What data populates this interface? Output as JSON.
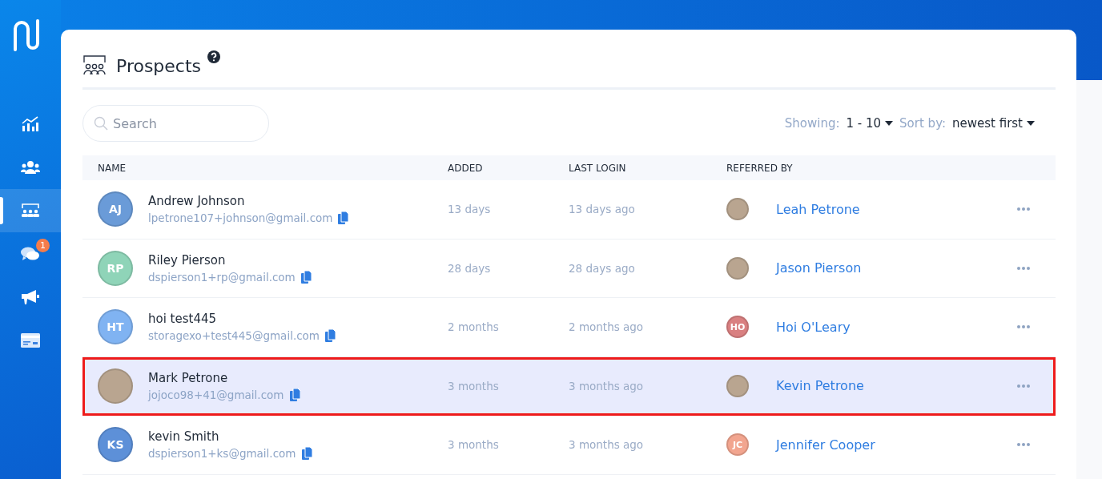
{
  "sidebar": {
    "items": [
      {
        "kind": "analytics",
        "selected": false
      },
      {
        "kind": "people",
        "selected": false
      },
      {
        "kind": "prospects",
        "selected": true
      },
      {
        "kind": "chat",
        "selected": false,
        "badge": "1"
      },
      {
        "kind": "megaphone",
        "selected": false
      },
      {
        "kind": "card",
        "selected": false
      }
    ]
  },
  "page": {
    "title": "Prospects"
  },
  "search": {
    "placeholder": "Search"
  },
  "showing": {
    "label": "Showing:",
    "value": "1 - 10"
  },
  "sort": {
    "label": "Sort by:",
    "value": "newest first"
  },
  "table": {
    "columns": [
      "NAME",
      "ADDED",
      "LAST LOGIN",
      "REFERRED BY"
    ],
    "rows": [
      {
        "selected": false,
        "avatar": {
          "kind": "initials",
          "initials": "AJ",
          "color": "#6a9bd8"
        },
        "name": "Andrew Johnson",
        "email": "lpetrone107+johnson@gmail.com",
        "added": "13 days",
        "last_login": "13 days ago",
        "referrer": {
          "avatar": {
            "kind": "photo"
          },
          "name": "Leah Petrone"
        }
      },
      {
        "selected": false,
        "avatar": {
          "kind": "initials",
          "initials": "RP",
          "color": "#8fd4b8"
        },
        "name": "Riley Pierson",
        "email": "dspierson1+rp@gmail.com",
        "added": "28 days",
        "last_login": "28 days ago",
        "referrer": {
          "avatar": {
            "kind": "photo"
          },
          "name": "Jason Pierson"
        }
      },
      {
        "selected": false,
        "avatar": {
          "kind": "initials",
          "initials": "HT",
          "color": "#80b3f2"
        },
        "name": "hoi test445",
        "email": "storagexo+test445@gmail.com",
        "added": "2 months",
        "last_login": "2 months ago",
        "referrer": {
          "avatar": {
            "kind": "initials",
            "initials": "HO",
            "color": "#d98081"
          },
          "name": "Hoi O'Leary"
        }
      },
      {
        "selected": true,
        "avatar": {
          "kind": "photo"
        },
        "name": "Mark Petrone",
        "email": "jojoco98+41@gmail.com",
        "added": "3 months",
        "last_login": "3 months ago",
        "referrer": {
          "avatar": {
            "kind": "photo"
          },
          "name": "Kevin Petrone"
        }
      },
      {
        "selected": false,
        "avatar": {
          "kind": "initials",
          "initials": "KS",
          "color": "#5d90d8"
        },
        "name": "kevin Smith",
        "email": "dspierson1+ks@gmail.com",
        "added": "3 months",
        "last_login": "3 months ago",
        "referrer": {
          "avatar": {
            "kind": "initials",
            "initials": "JC",
            "color": "#f2a58f"
          },
          "name": "Jennifer Cooper"
        }
      }
    ]
  }
}
